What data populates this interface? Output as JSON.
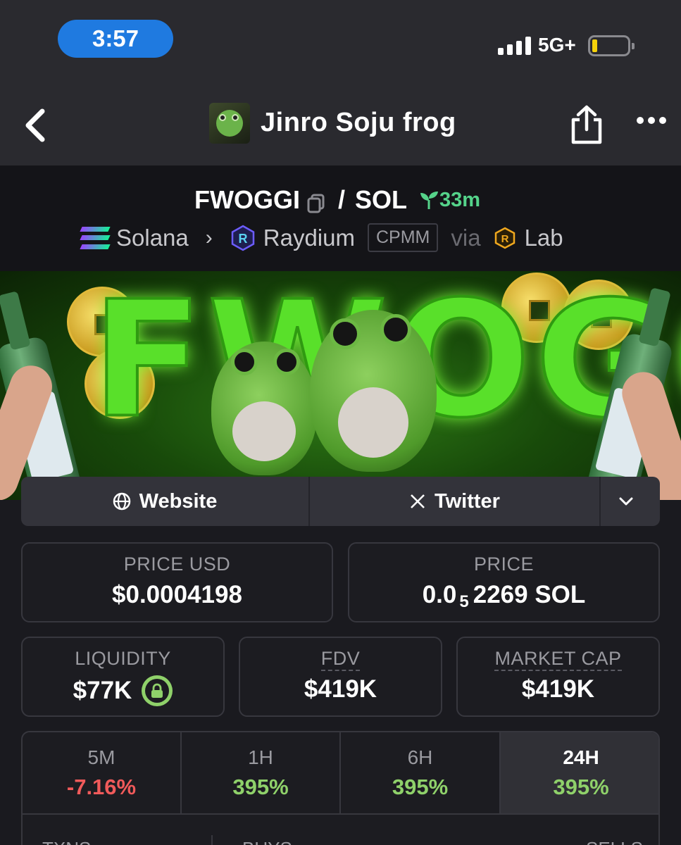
{
  "status_bar": {
    "time": "3:57",
    "network": "5G+",
    "battery_level": 0.1
  },
  "nav": {
    "title": "Jinro Soju frog",
    "back_icon": "chevron-left-icon",
    "share_icon": "share-icon",
    "more_icon": "more-horizontal-icon"
  },
  "pair": {
    "base": "FWOGGI",
    "separator": "/",
    "quote": "SOL",
    "age": "33m",
    "chain": "Solana",
    "dex": "Raydium",
    "pool_type": "CPMM",
    "via_label": "via",
    "launchpad": "Lab"
  },
  "banner": {
    "text": "FWOGGI"
  },
  "links": {
    "website": "Website",
    "twitter": "Twitter"
  },
  "price": {
    "usd_label": "PRICE USD",
    "usd_value": "$0.0004198",
    "native_label": "PRICE",
    "native_prefix": "0.0",
    "native_zeros": "5",
    "native_rest": "2269 SOL"
  },
  "metrics": {
    "liquidity_label": "LIQUIDITY",
    "liquidity_value": "$77K",
    "fdv_label": "FDV",
    "fdv_value": "$419K",
    "mcap_label": "MARKET CAP",
    "mcap_value": "$419K"
  },
  "changes": [
    {
      "label": "5M",
      "value": "-7.16%"
    },
    {
      "label": "1H",
      "value": "395%"
    },
    {
      "label": "6H",
      "value": "395%"
    },
    {
      "label": "24H",
      "value": "395%"
    }
  ],
  "txns": {
    "txns_label": "TXNS",
    "buys_label": "BUYS",
    "sells_label": "SELLS"
  },
  "colors": {
    "accent_green": "#8fd16a",
    "negative_red": "#f05a5a",
    "time_pill": "#1f7ae0"
  }
}
